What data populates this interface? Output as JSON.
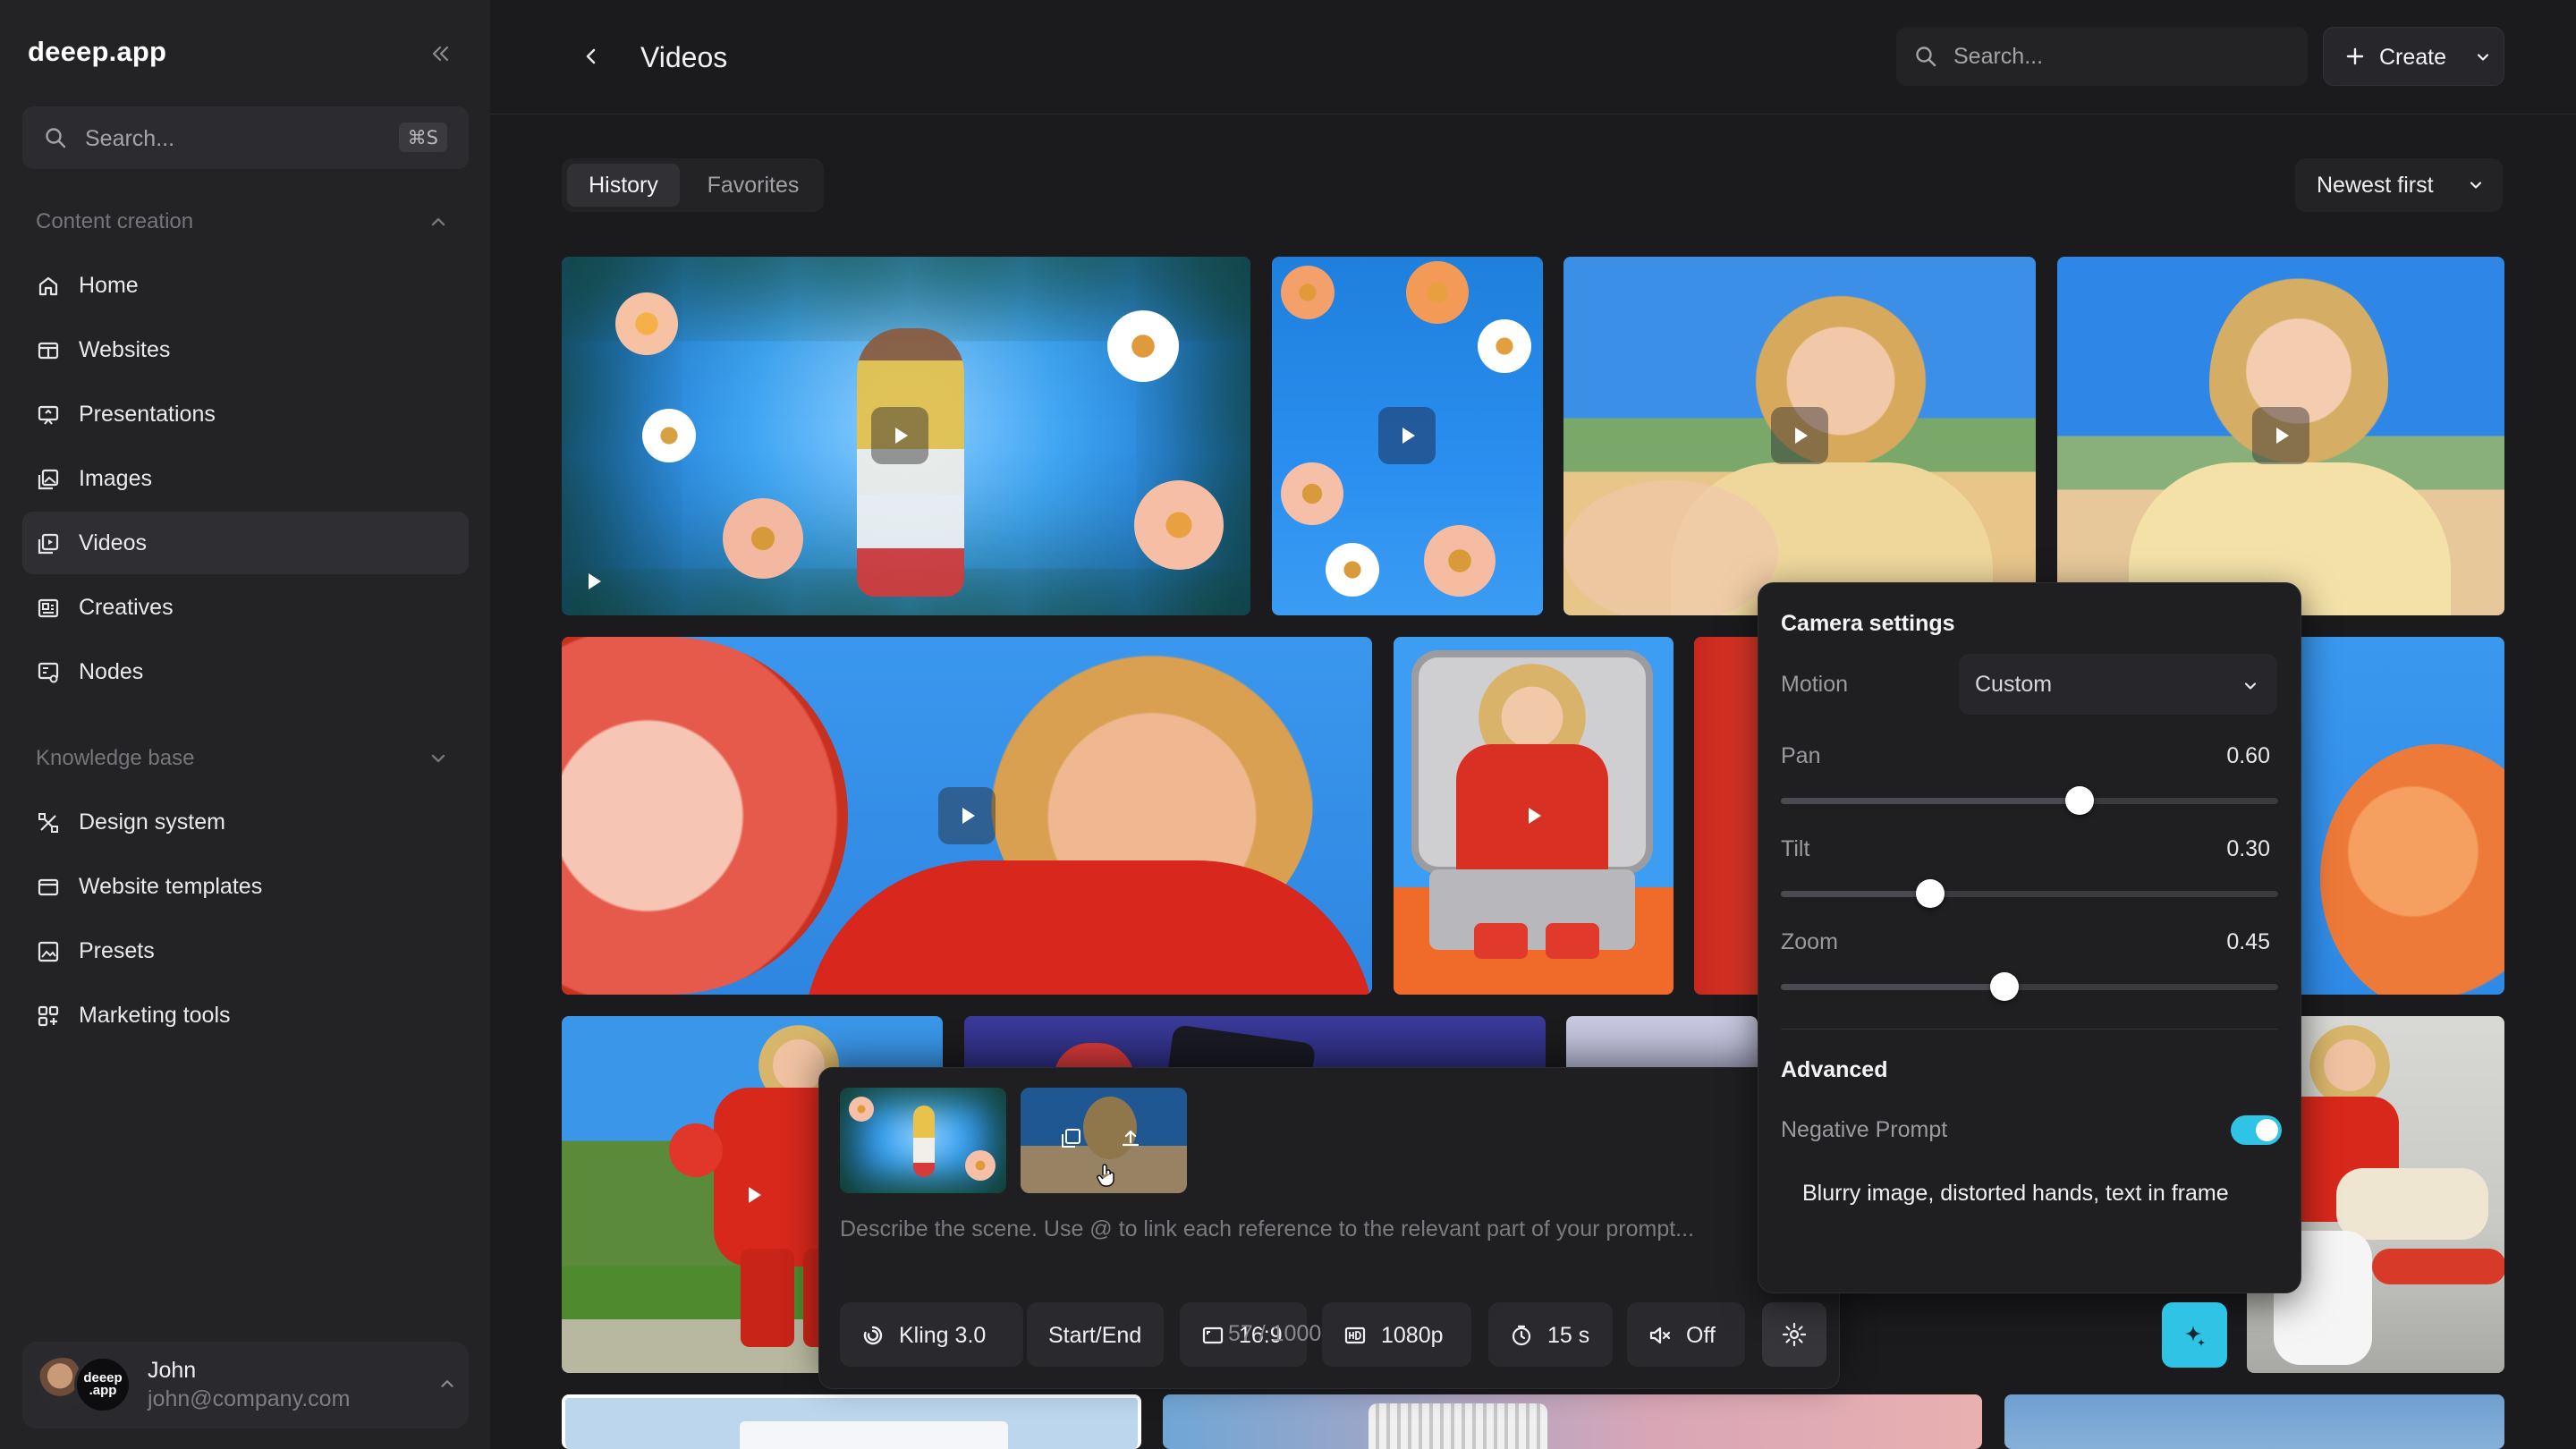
{
  "app": {
    "name": "deeep.app"
  },
  "sidebar": {
    "search": {
      "placeholder": "Search...",
      "shortcut": "⌘S"
    },
    "sections": [
      {
        "title": "Content creation",
        "expanded": true
      },
      {
        "title": "Knowledge base",
        "expanded": false
      }
    ],
    "content_items": [
      {
        "label": "Home",
        "icon": "home-icon"
      },
      {
        "label": "Websites",
        "icon": "browser-icon"
      },
      {
        "label": "Presentations",
        "icon": "presentation-icon"
      },
      {
        "label": "Images",
        "icon": "image-icon"
      },
      {
        "label": "Videos",
        "icon": "video-icon",
        "active": true
      },
      {
        "label": "Creatives",
        "icon": "creatives-icon"
      },
      {
        "label": "Nodes",
        "icon": "nodes-icon"
      }
    ],
    "knowledge_items": [
      {
        "label": "Design system",
        "icon": "design-tools-icon"
      },
      {
        "label": "Website templates",
        "icon": "window-icon"
      },
      {
        "label": "Presets",
        "icon": "preset-image-icon"
      },
      {
        "label": "Marketing tools",
        "icon": "grid-plus-icon"
      }
    ],
    "user": {
      "name": "John",
      "email": "john@company.com",
      "badge_line1": "deeep",
      "badge_line2": ".app"
    }
  },
  "header": {
    "title": "Videos",
    "search_placeholder": "Search...",
    "create_label": "Create"
  },
  "filters": {
    "tabs": [
      {
        "label": "History",
        "active": true
      },
      {
        "label": "Favorites",
        "active": false
      }
    ],
    "sort_label": "Newest first"
  },
  "composer": {
    "placeholder": "Describe the scene. Use @ to link each reference to the relevant part of your prompt...",
    "controls": {
      "model": "Kling 3.0",
      "frames": "Start/End",
      "aspect": "16:9",
      "resolution": "1080p",
      "duration": "15 s",
      "sound": "Off"
    },
    "counter": "57 / 1000"
  },
  "camera_settings": {
    "title": "Camera settings",
    "motion_label": "Motion",
    "motion_value": "Custom",
    "sliders": [
      {
        "label": "Pan",
        "value": 0.6,
        "display": "0.60"
      },
      {
        "label": "Tilt",
        "value": 0.3,
        "display": "0.30"
      },
      {
        "label": "Zoom",
        "value": 0.45,
        "display": "0.45"
      }
    ],
    "advanced_title": "Advanced",
    "negative_prompt_label": "Negative Prompt",
    "negative_prompt_enabled": true,
    "negative_prompt_text": "Blurry image, distorted hands, text in frame"
  },
  "colors": {
    "accent": "#2fc3e6",
    "background": "#1b1b1e",
    "sidebar": "#232326"
  }
}
